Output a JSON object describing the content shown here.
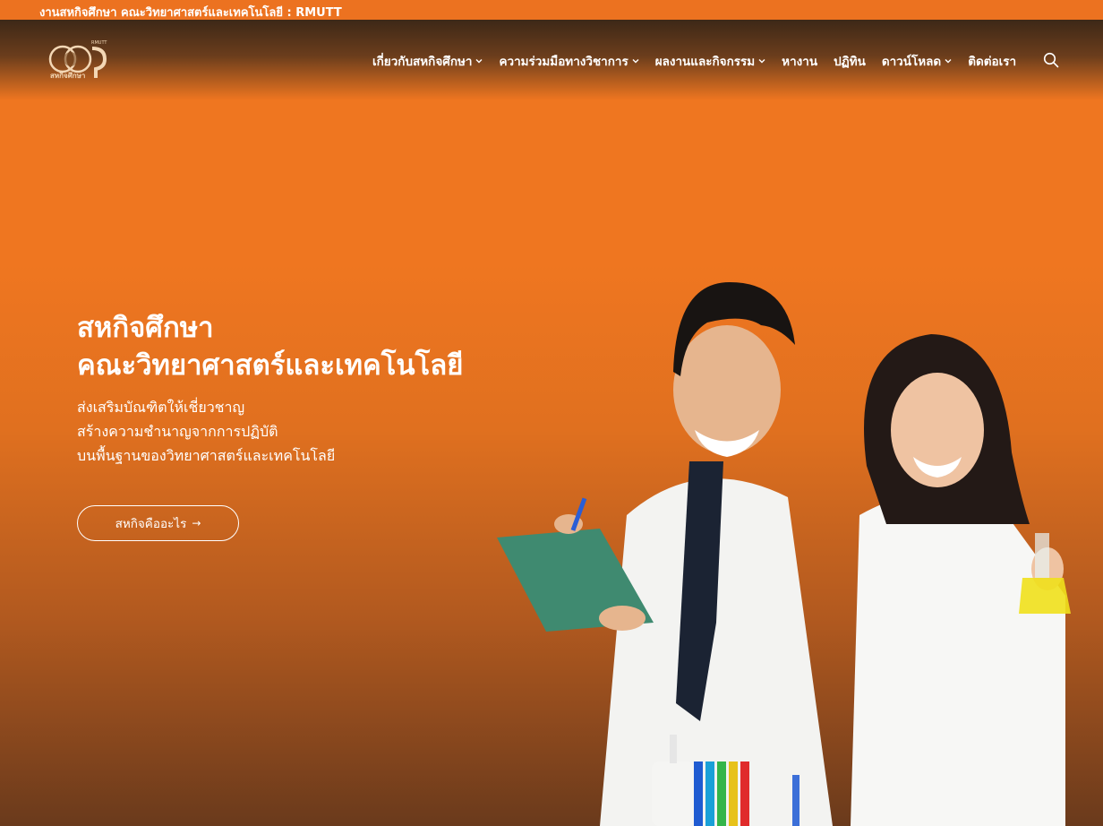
{
  "topbar": {
    "text": "งานสหกิจศึกษา คณะวิทยาศาสตร์และเทคโนโลยี : RMUTT"
  },
  "logo": {
    "caption": "สหกิจศึกษา",
    "tag": "RMUTT"
  },
  "nav": {
    "items": [
      {
        "label": "เกี่ยวกับสหกิจศึกษา",
        "dropdown": true
      },
      {
        "label": "ความร่วมมือทางวิชาการ",
        "dropdown": true
      },
      {
        "label": "ผลงานและกิจกรรม",
        "dropdown": true
      },
      {
        "label": "หางาน",
        "dropdown": false
      },
      {
        "label": "ปฏิทิน",
        "dropdown": false
      },
      {
        "label": "ดาวน์โหลด",
        "dropdown": true
      },
      {
        "label": "ติดต่อเรา",
        "dropdown": false
      }
    ],
    "search_icon": "search-icon"
  },
  "hero": {
    "title_line1": "สหกิจศึกษา",
    "title_line2": "คณะวิทยาศาสตร์และเทคโนโลยี",
    "sub_line1": "ส่งเสริมบัณฑิตให้เชี่ยวชาญ",
    "sub_line2": "สร้างความชำนาญจากการปฏิบัติ",
    "sub_line3": "บนพื้นฐานของวิทยาศาสตร์และเทคโนโลยี",
    "cta_label": "สหกิจคืออะไร",
    "cta_arrow": "→"
  },
  "colors": {
    "primary": "#ef7620",
    "dark": "#3d2817",
    "white": "#ffffff"
  }
}
